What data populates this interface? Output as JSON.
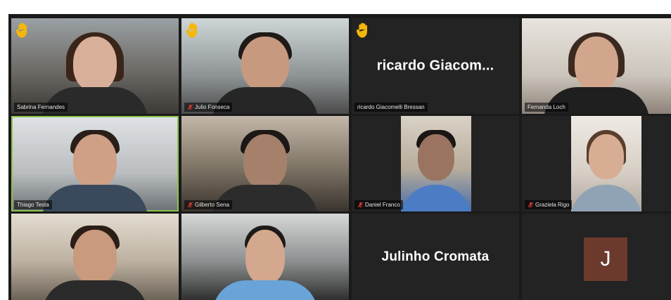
{
  "participants": [
    {
      "name": "Sabrina Fernandes"
    },
    {
      "name": "Julio Fonseca"
    },
    {
      "name": "ricardo Giacomelli Bressan",
      "display": "ricardo  Giacom..."
    },
    {
      "name": "Fernanda Loch"
    },
    {
      "name": "Thiago Testa"
    },
    {
      "name": "Gilberto Sena"
    },
    {
      "name": "Daniel Franco"
    },
    {
      "name": "Graziela Rigo"
    },
    {
      "name": ""
    },
    {
      "name": ""
    },
    {
      "name": "Julinho Cromata",
      "display": "Julinho Cromata"
    },
    {
      "name": "",
      "avatar_letter": "J"
    }
  ],
  "colors": {
    "speaking_border": "#8bc34a",
    "hand_yellow": "#f5b70a",
    "mute_red": "#e53935",
    "avatar_bg": "#6b3a2c"
  },
  "icons": [
    "raised-hand-icon",
    "muted-mic-icon"
  ]
}
